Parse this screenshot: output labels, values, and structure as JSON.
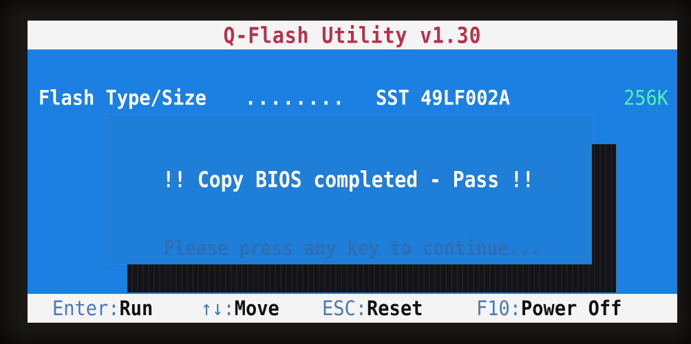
{
  "title": "Q-Flash Utility v1.30",
  "info": {
    "label": "Flash Type/Size",
    "dots": "........",
    "chip": "SST 49LF002A",
    "size": "256K"
  },
  "dialog": {
    "message": "!! Copy BIOS completed - Pass !!",
    "hint": "Please press any key to continue..."
  },
  "status_bar": {
    "items": [
      {
        "key": "Enter",
        "action": "Run"
      },
      {
        "key": "↑↓",
        "action": "Move"
      },
      {
        "key": "ESC",
        "action": "Reset"
      },
      {
        "key": "F10",
        "action": "Power Off"
      }
    ]
  },
  "colors": {
    "screen_background": "#1c7fe0",
    "title_text": "#b8304a",
    "size_text": "#4ff0b0",
    "bar_background": "#f4f4f4",
    "key_text": "#4a78b8"
  }
}
